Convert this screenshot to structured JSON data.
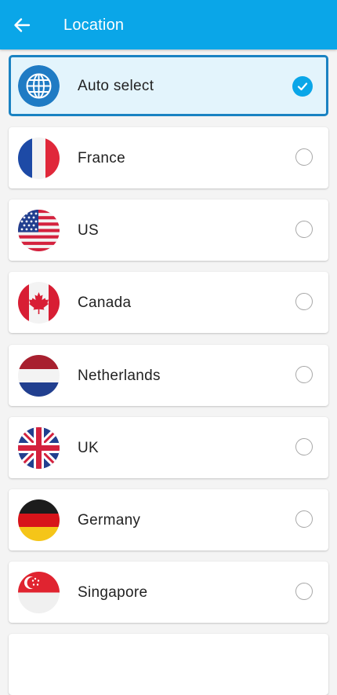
{
  "header": {
    "title": "Location",
    "back_icon": "arrow-left-icon",
    "background": "#0aa6e8"
  },
  "locations": [
    {
      "label": "Auto select",
      "icon": "globe-icon",
      "selected": true
    },
    {
      "label": "France",
      "icon": "france-flag-icon",
      "selected": false
    },
    {
      "label": "US",
      "icon": "us-flag-icon",
      "selected": false
    },
    {
      "label": "Canada",
      "icon": "canada-flag-icon",
      "selected": false
    },
    {
      "label": "Netherlands",
      "icon": "netherlands-flag-icon",
      "selected": false
    },
    {
      "label": "UK",
      "icon": "uk-flag-icon",
      "selected": false
    },
    {
      "label": "Germany",
      "icon": "germany-flag-icon",
      "selected": false
    },
    {
      "label": "Singapore",
      "icon": "singapore-flag-icon",
      "selected": false
    }
  ],
  "colors": {
    "accent": "#0aa6e8",
    "selected_border": "#1a82c2",
    "selected_background": "#e3f4fc"
  }
}
